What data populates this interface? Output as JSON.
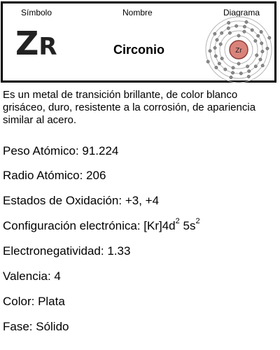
{
  "header": {
    "simbolo_label": "Símbolo",
    "nombre_label": "Nombre",
    "diagrama_label": "Diagrama"
  },
  "element": {
    "symbol_first": "Z",
    "symbol_second": "R",
    "name": "Circonio",
    "nucleus_label": "Zr",
    "electron_shells": [
      2,
      8,
      18,
      10,
      2
    ]
  },
  "description": "Es un metal de transición brillante, de color blanco grisáceo, duro, resistente a la corrosión, de apariencia similar al acero.",
  "properties": {
    "peso": "Peso Atómico: 91.224",
    "radio": "Radio Atómico: 206",
    "estados": "Estados de Oxidación: +3, +4",
    "config_prefix": "Configuración electrónica: [Kr]4d",
    "config_sup1": "2",
    "config_mid": " 5s",
    "config_sup2": "2",
    "electroneg": "Electronegatividad: 1.33",
    "valencia": "Valencia: 4",
    "color": "Color: Plata",
    "fase": "Fase: Sólido"
  },
  "colors": {
    "nucleus_fill": "#d9837b",
    "nucleus_stroke": "#8c3f39",
    "shell_stroke": "#b5b5b5",
    "electron_fill": "#8a8a8a",
    "electron_stroke": "#555555"
  }
}
